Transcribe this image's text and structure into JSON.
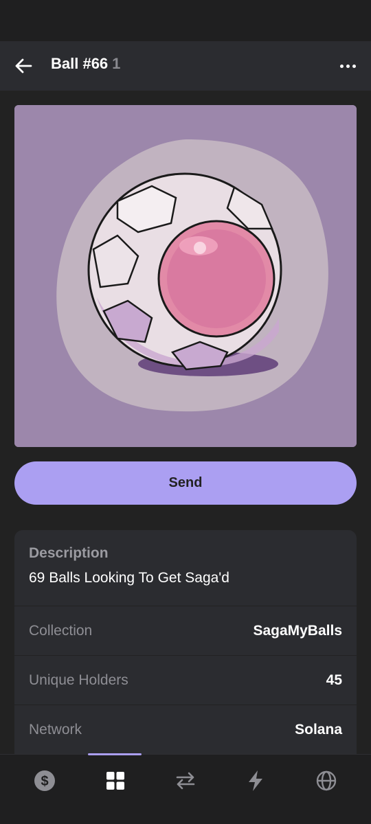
{
  "header": {
    "title": "Ball #66",
    "count": "1"
  },
  "nft": {
    "background_color": "#9c87ab",
    "ball_accent_color": "#d97aa0"
  },
  "actions": {
    "send_label": "Send"
  },
  "details": {
    "description_heading": "Description",
    "description_text": "69 Balls Looking To Get Saga'd",
    "rows": [
      {
        "label": "Collection",
        "value": "SagaMyBalls"
      },
      {
        "label": "Unique Holders",
        "value": "45"
      },
      {
        "label": "Network",
        "value": "Solana"
      }
    ]
  },
  "tabs": [
    {
      "icon": "dollar-icon",
      "active": false
    },
    {
      "icon": "grid-icon",
      "active": true
    },
    {
      "icon": "swap-icon",
      "active": false
    },
    {
      "icon": "lightning-icon",
      "active": false
    },
    {
      "icon": "globe-icon",
      "active": false
    }
  ],
  "colors": {
    "accent": "#ab9ff2",
    "background": "#222222",
    "card": "#2b2c30"
  }
}
